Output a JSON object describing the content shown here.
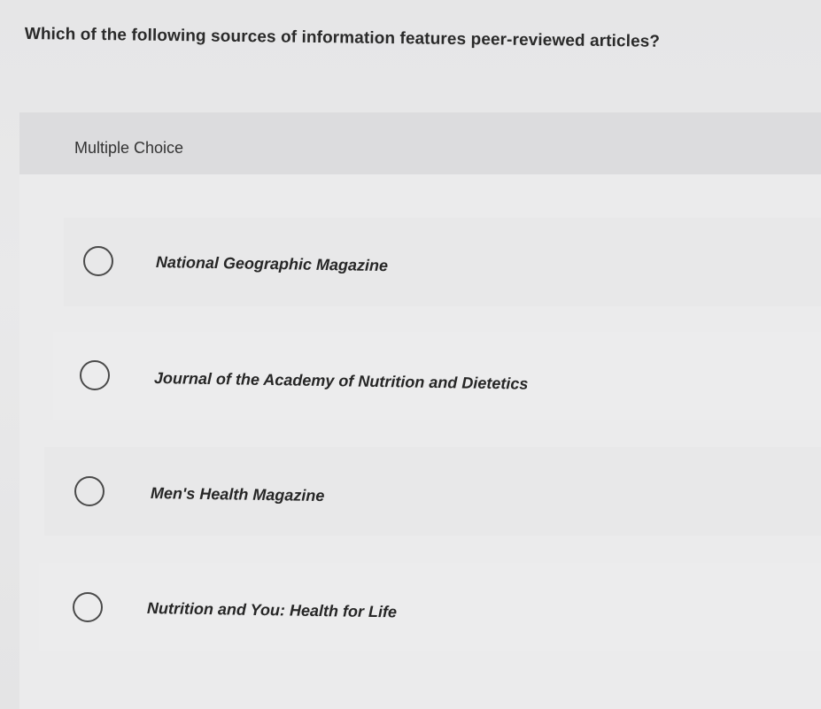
{
  "question": {
    "text": "Which of the following sources of information features peer-reviewed articles?"
  },
  "panel": {
    "header_label": "Multiple Choice"
  },
  "options": [
    {
      "label": "National Geographic Magazine",
      "selected": false
    },
    {
      "label": "Journal of the Academy of Nutrition and Dietetics",
      "selected": false
    },
    {
      "label": "Men's Health Magazine",
      "selected": false
    },
    {
      "label": "Nutrition and You: Health for Life",
      "selected": false
    }
  ]
}
